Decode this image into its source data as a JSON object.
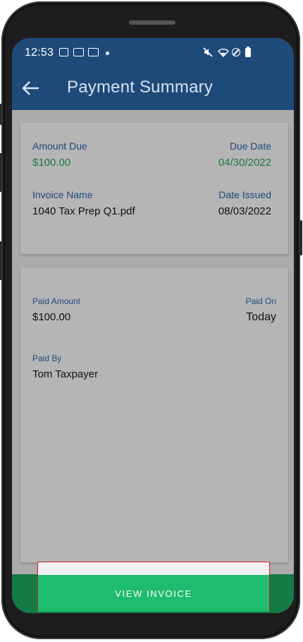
{
  "status_bar": {
    "time": "12:53"
  },
  "header": {
    "title": "Payment Summary"
  },
  "invoice_card": {
    "amount_due_label": "Amount Due",
    "amount_due_value": "$100.00",
    "due_date_label": "Due Date",
    "due_date_value": "04/30/2022",
    "invoice_name_label": "Invoice Name",
    "invoice_name_value": "1040 Tax Prep Q1.pdf",
    "date_issued_label": "Date Issued",
    "date_issued_value": "08/03/2022"
  },
  "payment_card": {
    "paid_amount_label": "Paid Amount",
    "paid_amount_value": "$100.00",
    "paid_on_label": "Paid On",
    "paid_on_value": "Today",
    "paid_by_label": "Paid By",
    "paid_by_value": "Tom Taxpayer"
  },
  "actions": {
    "view_invoice_label": "VIEW INVOICE"
  },
  "colors": {
    "app_bar": "#1e4a7a",
    "accent_green": "#1fbb6e",
    "amount_green": "#1f7a3e",
    "label_blue": "#1e4a7a"
  }
}
